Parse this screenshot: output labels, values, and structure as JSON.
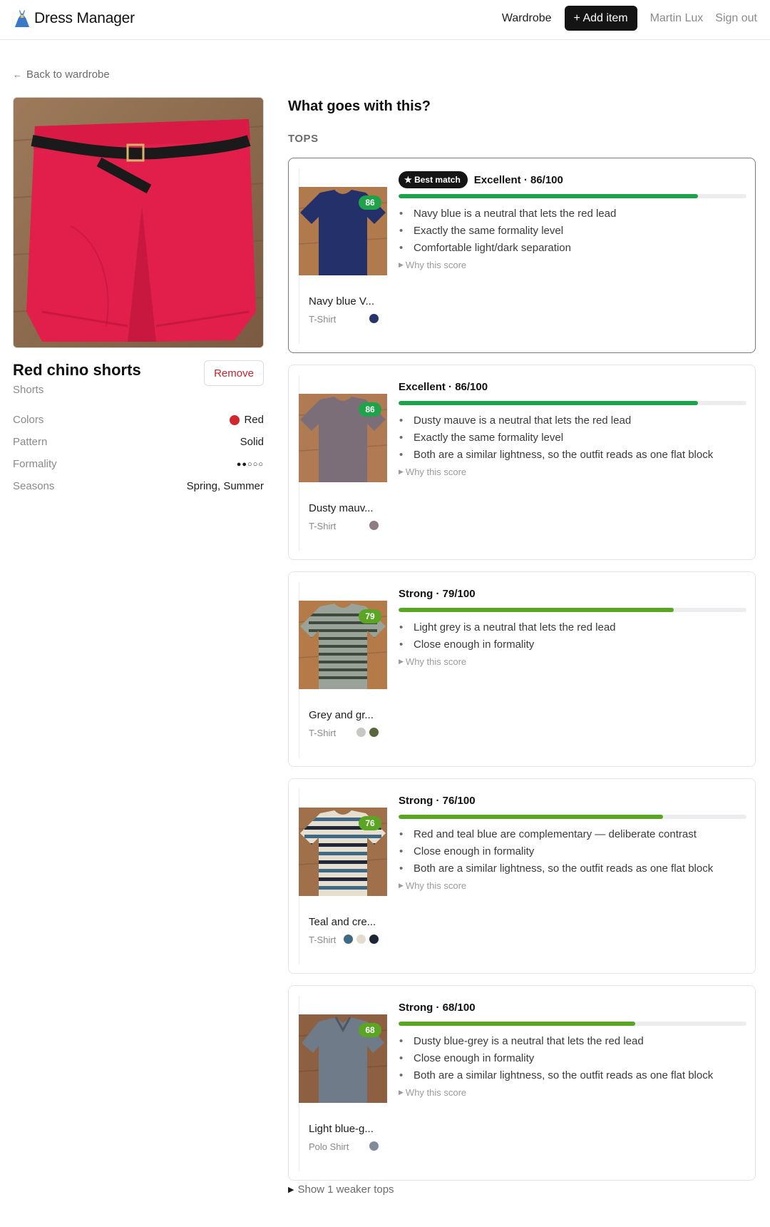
{
  "app": {
    "name": "Dress Manager"
  },
  "nav": {
    "wardrobe": "Wardrobe",
    "add_item": "+ Add item",
    "user": "Martin Lux",
    "sign_out": "Sign out"
  },
  "back": {
    "label": "Back to wardrobe"
  },
  "item": {
    "title": "Red chino shorts",
    "type": "Shorts",
    "remove_label": "Remove",
    "attributes": [
      {
        "label": "Colors",
        "value": "Red",
        "color": "#d0272e"
      },
      {
        "label": "Pattern",
        "value": "Solid"
      },
      {
        "label": "Formality",
        "value": "●●○○○",
        "level": 2,
        "max": 5
      },
      {
        "label": "Seasons",
        "value": "Spring, Summer"
      }
    ]
  },
  "matches": {
    "title": "What goes with this?",
    "category": "TOPS",
    "best_badge": "★ Best match",
    "why_label": "Why this score",
    "show_weaker": "Show 1 weaker tops",
    "cards": [
      {
        "best": true,
        "score": "86",
        "score_value": 86,
        "verdict": "Excellent · 86/100",
        "bar_color": "#1fa34a",
        "name": "Navy blue V...",
        "type": "T-Shirt",
        "swatches": [
          "#27356a"
        ],
        "photo": "navy",
        "reasons": [
          "Navy blue is a neutral that lets the red lead",
          "Exactly the same formality level",
          "Comfortable light/dark separation"
        ]
      },
      {
        "best": false,
        "score": "86",
        "score_value": 86,
        "verdict": "Excellent · 86/100",
        "bar_color": "#1fa34a",
        "name": "Dusty mauv...",
        "type": "T-Shirt",
        "swatches": [
          "#8d7c86"
        ],
        "photo": "mauve",
        "reasons": [
          "Dusty mauve is a neutral that lets the red lead",
          "Exactly the same formality level",
          "Both are a similar lightness, so the outfit reads as one flat block"
        ]
      },
      {
        "best": false,
        "score": "79",
        "score_value": 79,
        "verdict": "Strong · 79/100",
        "bar_color": "#5aa524",
        "name": "Grey and gr...",
        "type": "T-Shirt",
        "swatches": [
          "#c8c8c0",
          "#58683a"
        ],
        "photo": "grey",
        "reasons": [
          "Light grey is a neutral that lets the red lead",
          "Close enough in formality"
        ]
      },
      {
        "best": false,
        "score": "76",
        "score_value": 76,
        "verdict": "Strong · 76/100",
        "bar_color": "#5aa524",
        "name": "Teal and cre...",
        "type": "T-Shirt",
        "swatches": [
          "#3f6a86",
          "#e4dccd",
          "#1c2636"
        ],
        "photo": "teal",
        "reasons": [
          "Red and teal blue are complementary — deliberate contrast",
          "Close enough in formality",
          "Both are a similar lightness, so the outfit reads as one flat block"
        ]
      },
      {
        "best": false,
        "score": "68",
        "score_value": 68,
        "verdict": "Strong · 68/100",
        "bar_color": "#5aa524",
        "name": "Light blue-g...",
        "type": "Polo Shirt",
        "swatches": [
          "#7f8b97"
        ],
        "photo": "polo",
        "reasons": [
          "Dusty blue-grey is a neutral that lets the red lead",
          "Close enough in formality",
          "Both are a similar lightness, so the outfit reads as one flat block"
        ]
      }
    ]
  }
}
